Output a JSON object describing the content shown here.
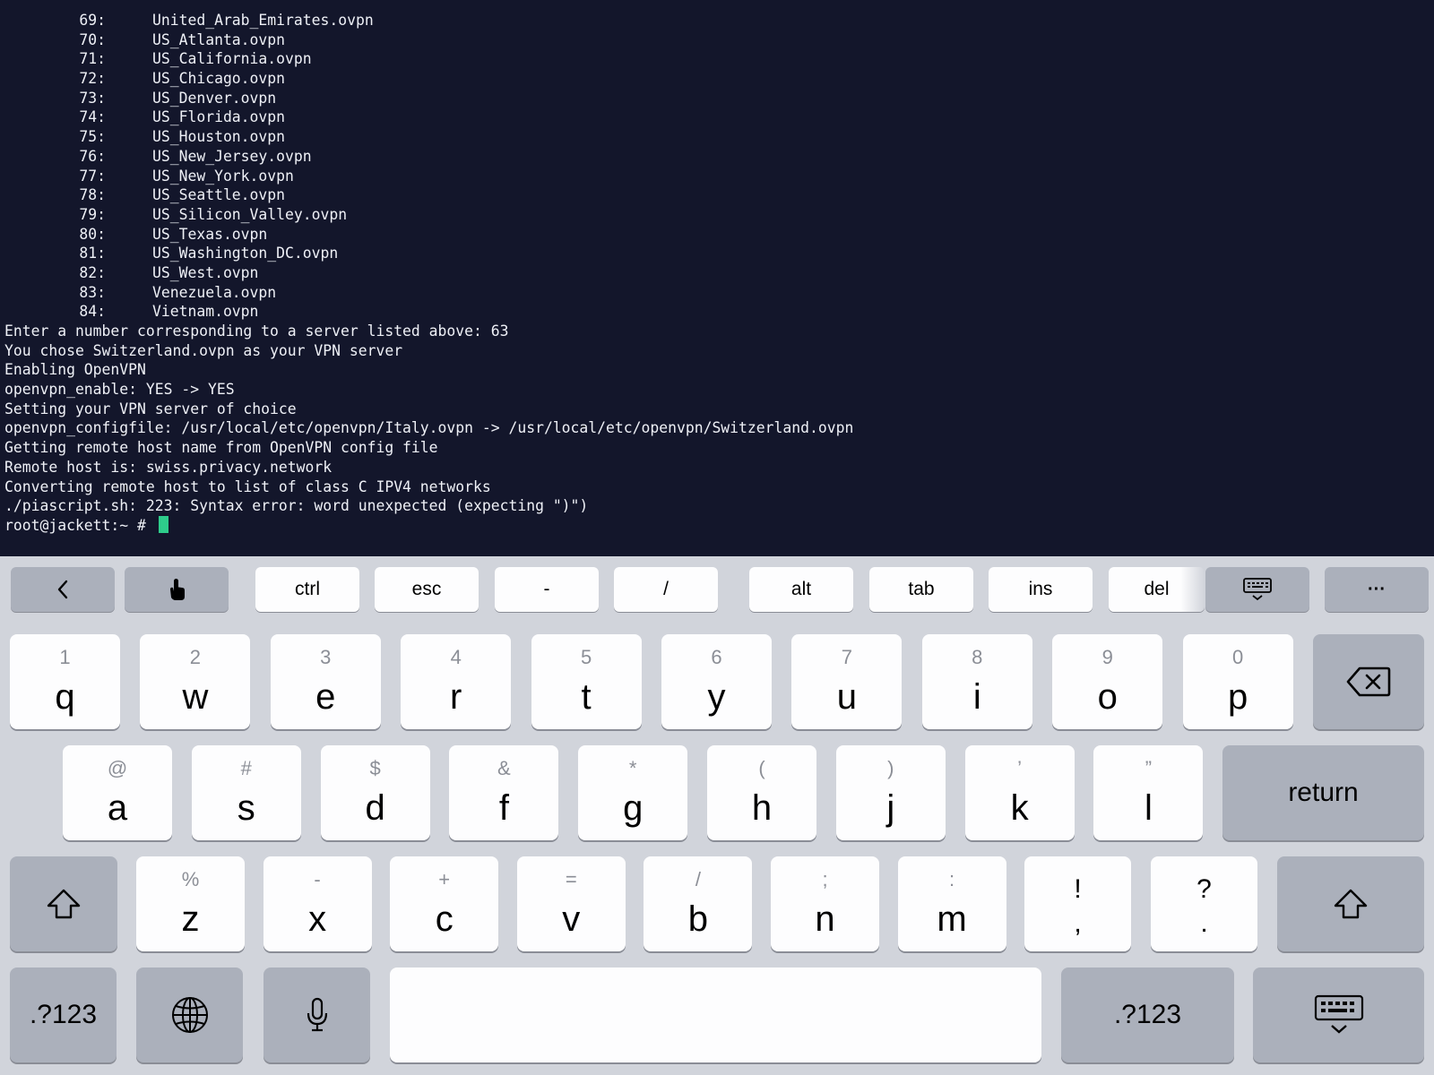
{
  "terminal": {
    "server_list": [
      {
        "num": "69:",
        "file": "United_Arab_Emirates.ovpn"
      },
      {
        "num": "70:",
        "file": "US_Atlanta.ovpn"
      },
      {
        "num": "71:",
        "file": "US_California.ovpn"
      },
      {
        "num": "72:",
        "file": "US_Chicago.ovpn"
      },
      {
        "num": "73:",
        "file": "US_Denver.ovpn"
      },
      {
        "num": "74:",
        "file": "US_Florida.ovpn"
      },
      {
        "num": "75:",
        "file": "US_Houston.ovpn"
      },
      {
        "num": "76:",
        "file": "US_New_Jersey.ovpn"
      },
      {
        "num": "77:",
        "file": "US_New_York.ovpn"
      },
      {
        "num": "78:",
        "file": "US_Seattle.ovpn"
      },
      {
        "num": "79:",
        "file": "US_Silicon_Valley.ovpn"
      },
      {
        "num": "80:",
        "file": "US_Texas.ovpn"
      },
      {
        "num": "81:",
        "file": "US_Washington_DC.ovpn"
      },
      {
        "num": "82:",
        "file": "US_West.ovpn"
      },
      {
        "num": "83:",
        "file": "Venezuela.ovpn"
      },
      {
        "num": "84:",
        "file": "Vietnam.ovpn"
      }
    ],
    "output_lines": [
      "Enter a number corresponding to a server listed above: 63",
      "You chose Switzerland.ovpn as your VPN server",
      "Enabling OpenVPN",
      "openvpn_enable: YES -> YES",
      "Setting your VPN server of choice",
      "openvpn_configfile: /usr/local/etc/openvpn/Italy.ovpn -> /usr/local/etc/openvpn/Switzerland.ovpn",
      "Getting remote host name from OpenVPN config file",
      "Remote host is: swiss.privacy.network",
      "Converting remote host to list of class C IPV4 networks",
      "./piascript.sh: 223: Syntax error: word unexpected (expecting \")\")"
    ],
    "prompt": "root@jackett:~ # ",
    "cursor_color": "#2ecc8b",
    "background": "#13162b"
  },
  "toolbar": {
    "back_icon": "chevron-left-icon",
    "touch_icon": "touch-pointer-icon",
    "ctrl": "ctrl",
    "esc": "esc",
    "dash": "-",
    "slash": "/",
    "alt": "alt",
    "tab": "tab",
    "ins": "ins",
    "del": "del",
    "keyboard_icon": "keyboard-toggle-icon",
    "more": "···"
  },
  "keyboard": {
    "row1": [
      {
        "hint": "1",
        "key": "q"
      },
      {
        "hint": "2",
        "key": "w"
      },
      {
        "hint": "3",
        "key": "e"
      },
      {
        "hint": "4",
        "key": "r"
      },
      {
        "hint": "5",
        "key": "t"
      },
      {
        "hint": "6",
        "key": "y"
      },
      {
        "hint": "7",
        "key": "u"
      },
      {
        "hint": "8",
        "key": "i"
      },
      {
        "hint": "9",
        "key": "o"
      },
      {
        "hint": "0",
        "key": "p"
      }
    ],
    "row2": [
      {
        "hint": "@",
        "key": "a"
      },
      {
        "hint": "#",
        "key": "s"
      },
      {
        "hint": "$",
        "key": "d"
      },
      {
        "hint": "&",
        "key": "f"
      },
      {
        "hint": "*",
        "key": "g"
      },
      {
        "hint": "(",
        "key": "h"
      },
      {
        "hint": ")",
        "key": "j"
      },
      {
        "hint": "’",
        "key": "k"
      },
      {
        "hint": "”",
        "key": "l"
      }
    ],
    "row3": [
      {
        "hint": "%",
        "key": "z"
      },
      {
        "hint": "-",
        "key": "x"
      },
      {
        "hint": "+",
        "key": "c"
      },
      {
        "hint": "=",
        "key": "v"
      },
      {
        "hint": "/",
        "key": "b"
      },
      {
        "hint": ";",
        "key": "n"
      },
      {
        "hint": ":",
        "key": "m"
      }
    ],
    "punct1": {
      "top": "!",
      "bottom": ","
    },
    "punct2": {
      "top": "?",
      "bottom": "."
    },
    "return": "return",
    "numbers": ".?123",
    "numbers_right": ".?123"
  }
}
